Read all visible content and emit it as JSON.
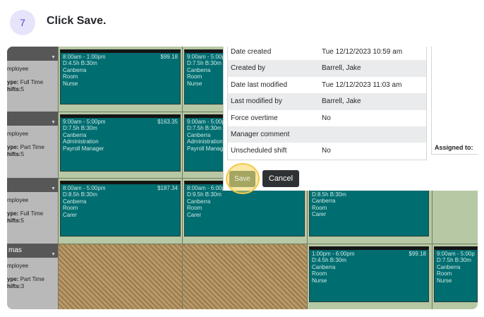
{
  "step": {
    "number": "7",
    "title": "Click Save."
  },
  "employees": [
    {
      "name": "",
      "label": "mployee",
      "type_key": "ype:",
      "type_val": "Full Time",
      "shifts_key": "hifts:",
      "shifts_val": "5"
    },
    {
      "name": "",
      "label": "mployee",
      "type_key": "ype:",
      "type_val": "Part Time",
      "shifts_key": "hifts:",
      "shifts_val": "5"
    },
    {
      "name": "",
      "label": "mployee",
      "type_key": "ype:",
      "type_val": "Full Time",
      "shifts_key": "hifts:",
      "shifts_val": "5"
    },
    {
      "name": "mas",
      "label": "mployee",
      "type_key": "ype:",
      "type_val": "Part Time",
      "shifts_key": "hifts:",
      "shifts_val": "3"
    }
  ],
  "shifts": [
    {
      "time": "8:00am - 1:00pm",
      "price": "$99.18",
      "break": "D:4.5h B:30m",
      "location": "Canberra",
      "area": "Room",
      "role": "Nurse"
    },
    {
      "time": "9:00am - 5:00p",
      "price": "",
      "break": "D:7.5h B:30m",
      "location": "Canberra",
      "area": "Room",
      "role": "Nurse"
    },
    {
      "time": "9:00am - 5:00pm",
      "price": "$163.35",
      "break": "D:7.5h B:30m",
      "location": "Canberra",
      "area": "Administration",
      "role": "Payroll Manager"
    },
    {
      "time": "9:00am - 5:00p",
      "price": "",
      "break": "D:7.5h B:30m",
      "location": "Canberra",
      "area": "Administration",
      "role": "Payroll Manag"
    },
    {
      "time": "8:00am - 5:00pm",
      "price": "$187.34",
      "break": "D:8.5h B:30m",
      "location": "Canberra",
      "area": "Room",
      "role": "Carer"
    },
    {
      "time": "8:00am - 6:00p",
      "price": "",
      "break": "D:9.5h B:30m",
      "location": "Canberra",
      "area": "Room",
      "role": "Carer"
    },
    {
      "time": "",
      "price": "",
      "break": "D:8.5h B:30m",
      "location": "Canberra",
      "area": "Room",
      "role": "Carer"
    },
    {
      "time": "1:00pm - 6:00pm",
      "price": "$99.18",
      "break": "D:4.5h B:30m",
      "location": "Canberra",
      "area": "Room",
      "role": "Nurse"
    },
    {
      "time": "9:00am - 5:00p",
      "price": "",
      "break": "D:7.5h B:30m",
      "location": "Canberra",
      "area": "Room",
      "role": "Nurse"
    }
  ],
  "details": [
    {
      "label": "Date created",
      "value": "Tue 12/12/2023 10:59 am"
    },
    {
      "label": "Created by",
      "value": "Barrell, Jake"
    },
    {
      "label": "Date last modified",
      "value": "Tue 12/12/2023 11:03 am"
    },
    {
      "label": "Last modified by",
      "value": "Barrell, Jake"
    },
    {
      "label": "Force overtime",
      "value": "No"
    },
    {
      "label": "Manager comment",
      "value": ""
    },
    {
      "label": "Unscheduled shift",
      "value": "No"
    }
  ],
  "assigned_label": "Assigned to:",
  "buttons": {
    "save": "Save",
    "cancel": "Cancel"
  },
  "colors": {
    "shift_bg": "#006d70",
    "save_bg": "#a4a662",
    "cancel_bg": "#2f3234",
    "highlight": "#f3c94d",
    "badge_bg": "#e5e4fb",
    "badge_text": "#4a47d1"
  }
}
